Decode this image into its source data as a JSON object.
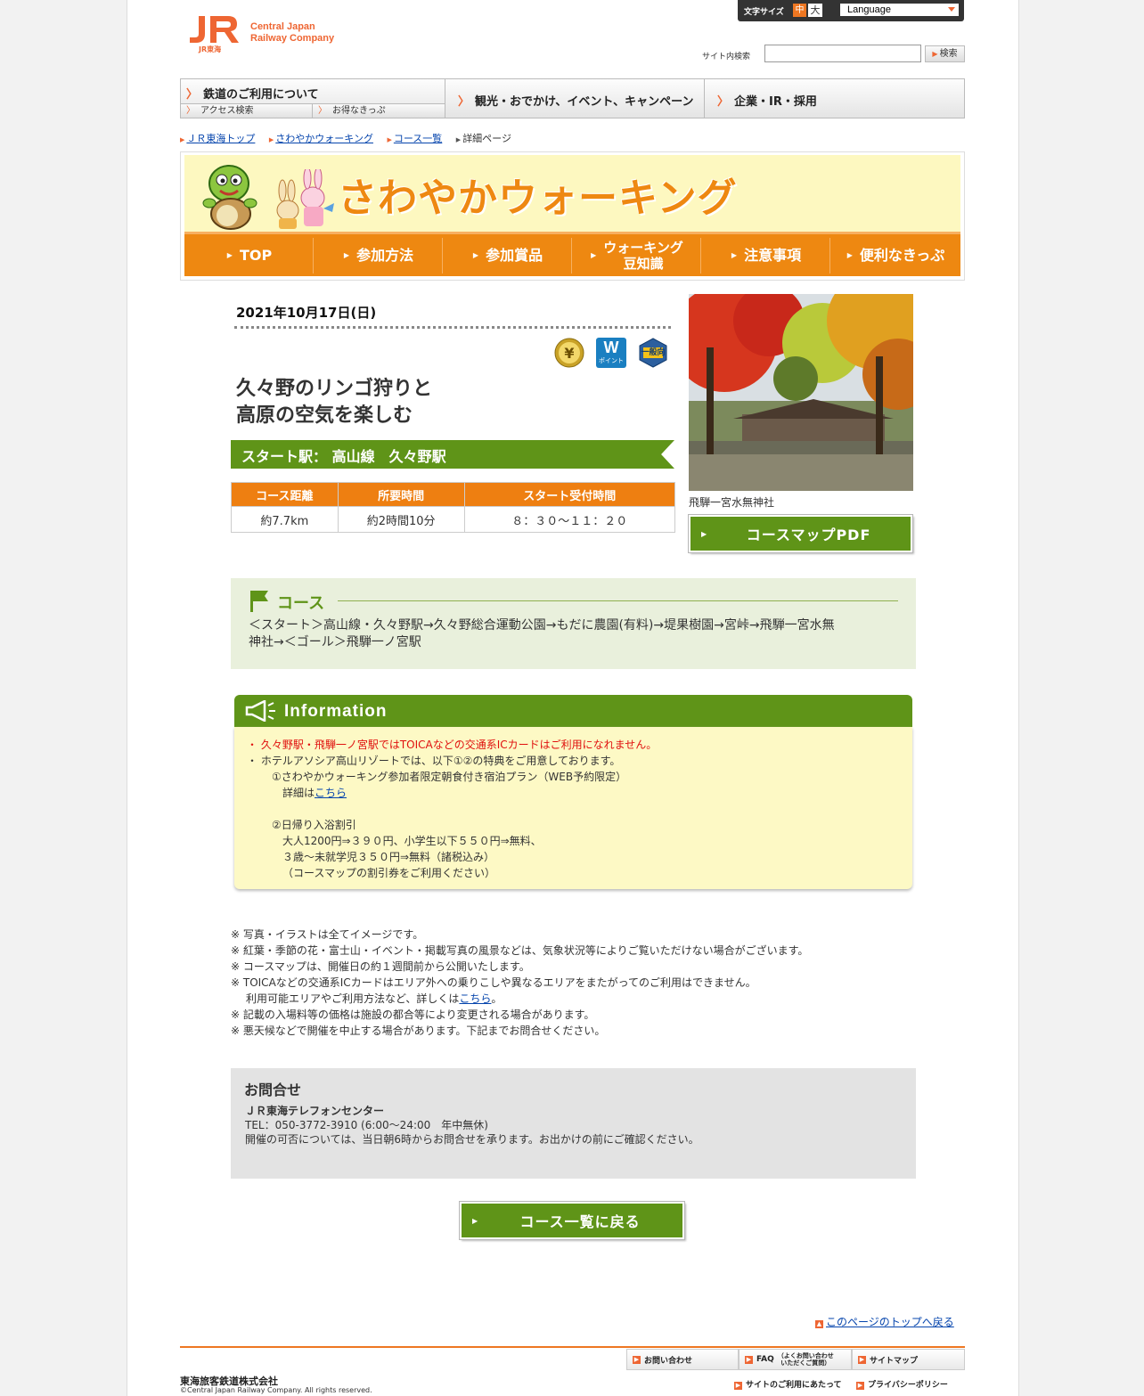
{
  "header": {
    "logo_mark": "JR",
    "logo_sub": "JR東海",
    "logo_name_line1": "Central Japan",
    "logo_name_line2": "Railway Company",
    "font_size_label": "文字サイズ",
    "font_size_medium": "中",
    "font_size_large": "大",
    "language_label": "Language",
    "search_label": "サイト内検索",
    "search_placeholder": "",
    "search_button": "検索"
  },
  "global_nav": {
    "railway": "鉄道のご利用について",
    "access": "アクセス検索",
    "tickets": "お得なきっぷ",
    "tourism": "観光・おでかけ、イベント、キャンペーン",
    "corporate": "企業・IR・採用"
  },
  "breadcrumb": {
    "items": [
      "ＪＲ東海トップ",
      "さわやかウォーキング",
      "コース一覧"
    ],
    "current": "詳細ページ"
  },
  "banner": {
    "title": "さわやかウォーキング",
    "nav": [
      "TOP",
      "参加方法",
      "参加賞品",
      "ウォーキング",
      "豆知識",
      "注意事項",
      "便利なきっぷ"
    ]
  },
  "event": {
    "date": "2021年10月17日(日)",
    "badges": [
      "yen-icon",
      "w-point-icon",
      "general-icon"
    ],
    "badge_w": "W",
    "badge_w_sub": "ポイント",
    "badge_general": "一般向",
    "title_line1": "久々野のリンゴ狩りと",
    "title_line2": "高原の空気を楽しむ",
    "start_label": "スタート駅：",
    "start_station": "高山線　久々野駅",
    "table": {
      "headers": [
        "コース距離",
        "所要時間",
        "スタート受付時間"
      ],
      "values": [
        "約7.7km",
        "約2時間10分",
        "８：３０～１１：２０"
      ]
    },
    "photo_caption": "飛騨一宮水無神社",
    "pdf_button": "コースマップPDF"
  },
  "course": {
    "heading": "コース",
    "route_line1": "＜スタート＞高山線・久々野駅→久々野総合運動公園→もだに農園(有料)→堤果樹園→宮峠→飛騨一宮水無",
    "route_line2": "神社→＜ゴール＞飛騨一ノ宮駅"
  },
  "information": {
    "heading": "Information",
    "line1": "・ 久々野駅・飛騨一ノ宮駅ではTOICAなどの交通系ICカードはご利用になれません。",
    "line2": "・ ホテルアソシア高山リゾートでは、以下①②の特典をご用意しております。",
    "line3": "①さわやかウォーキング参加者限定朝食付き宿泊プラン（WEB予約限定）",
    "line4_prefix": "詳細は",
    "line4_link": "こちら",
    "line5": "②日帰り入浴割引",
    "line6": "大人1200円⇒３９０円、小学生以下５５０円⇒無料、",
    "line7": "３歳～未就学児３５０円⇒無料（諸税込み）",
    "line8": "（コースマップの割引券をご利用ください）"
  },
  "notes": {
    "n1": "※ 写真・イラストは全てイメージです。",
    "n2": "※ 紅葉・季節の花・富士山・イベント・掲載写真の風景などは、気象状況等によりご覧いただけない場合がございます。",
    "n3": "※ コースマップは、開催日の約１週間前から公開いたします。",
    "n4": "※ TOICAなどの交通系ICカードはエリア外への乗りこしや異なるエリアをまたがってのご利用はできません。",
    "n5_prefix": "利用可能エリアやご利用方法など、詳しくは",
    "n5_link": "こちら",
    "n5_suffix": "。",
    "n6": "※ 記載の入場料等の価格は施設の都合等により変更される場合があります。",
    "n7": "※ 悪天候などで開催を中止する場合があります。下記までお問合せください。"
  },
  "contact": {
    "heading": "お問合せ",
    "center": "ＪＲ東海テレフォンセンター",
    "tel": "TEL：050-3772-3910 (6:00～24:00　年中無休)",
    "note": "開催の可否については、当日朝6時からお問合せを承ります。お出かけの前にご確認ください。"
  },
  "back_button": "コース一覧に戻る",
  "to_top": "このページのトップへ戻る",
  "footer": {
    "inquiry": "お問い合わせ",
    "faq": "FAQ",
    "faq_sub1": "（よくお問い合わせ",
    "faq_sub2": "いただくご質問）",
    "sitemap": "サイトマップ",
    "terms": "サイトのご利用にあたって",
    "privacy": "プライバシーポリシー",
    "company": "東海旅客鉄道株式会社",
    "copyright": "©Central Japan Railway Company. All rights reserved."
  }
}
